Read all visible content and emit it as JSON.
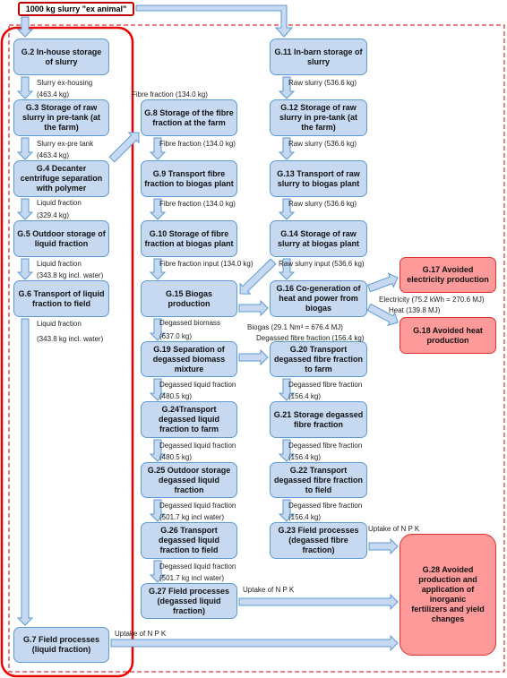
{
  "source": "1000 kg slurry \"ex animal\"",
  "boxes": {
    "g2": "G.2 In-house storage of slurry",
    "g3": "G.3 Storage of raw slurry in pre-tank (at the farm)",
    "g4": "G.4 Decanter centrifuge separation with polymer",
    "g5": "G.5 Outdoor storage of liquid fraction",
    "g6": "G.6 Transport of liquid fraction to field",
    "g7": "G.7 Field processes (liquid fraction)",
    "g8": "G.8 Storage of the fibre fraction at the farm",
    "g9": "G.9 Transport fibre fraction to biogas plant",
    "g10": "G.10 Storage of fibre fraction at biogas plant",
    "g15": "G.15 Biogas production",
    "g19": "G.19 Separation of degassed biomass mixture",
    "g24": "G.24Transport degassed liquid fraction to farm",
    "g25": "G.25 Outdoor storage degassed liquid fraction",
    "g26": "G.26 Transport degassed liquid fraction to field",
    "g27": "G.27 Field processes (degassed liquid fraction)",
    "g11": "G.11 In-barn storage of slurry",
    "g12": "G.12 Storage of raw slurry in pre-tank (at the farm)",
    "g13": "G.13 Transport of raw slurry to biogas plant",
    "g14": "G.14 Storage of raw slurry at biogas plant",
    "g16": "G.16 Co-generation of heat and power from biogas",
    "g20": "G.20 Transport degassed fibre fraction to farm",
    "g21": "G.21 Storage degassed fibre fraction",
    "g22": "G.22 Transport degassed fibre fraction to field",
    "g23": "G.23 Field processes (degassed fibre fraction)",
    "g17": "G.17 Avoided electricity production",
    "g18": "G.18 Avoided heat production",
    "g28": "G.28 Avoided production and application of inorganic fertilizers and yield changes"
  },
  "labels": {
    "l1a": "Slurry ex-housing",
    "l1b": "(463.4 kg)",
    "l2a": "Slurry ex-pre tank",
    "l2b": "(463.4 kg)",
    "l3a": "Liquid fraction",
    "l3b": "(329.4 kg)",
    "l4a": "Liquid fraction",
    "l4b": "(343.8 kg incl. water)",
    "l5a": "Liquid fraction",
    "l5b": "(343.8 kg incl. water)",
    "f0": "Fibre fraction (134.0 kg)",
    "f1": "Fibre fraction (134.0 kg)",
    "f2": "Fibre fraction (134.0 kg)",
    "f3": "Fibre fraction input (134.0 kg)",
    "r1": "Raw slurry (536.6 kg)",
    "r2": "Raw slurry (536.6 kg)",
    "r3": "Raw slurry (536.6 kg)",
    "r4": "Raw slurry input (536.6 kg)",
    "elec": "Electricity (75.2 kWh = 270.6 MJ)",
    "heat": "Heat (139.8 MJ)",
    "biogas": "Biogas (29.1 Nm³ = 676.4 MJ)",
    "dff": "Degassed fibre fraction (156.4 kg)",
    "db1": "Degassed biomass",
    "db2": "(637.0 kg)",
    "d1a": "Degassed liquid fraction",
    "d1b": "(480.5 kg)",
    "d2a": "Degassed liquid fraction",
    "d2b": "(480.5 kg)",
    "d3a": "Degassed liquid fraction",
    "d3b": "(501.7 kg incl water)",
    "d4a": "Degassed liquid fraction",
    "d4b": "(501.7 kg incl water)",
    "e1a": "Degassed fibre fraction",
    "e1b": "(156.4 kg)",
    "e2a": "Degassed fibre fraction",
    "e2b": "(156.4 kg)",
    "e3a": "Degassed fibre fraction",
    "e3b": "(156.4 kg)",
    "u1": "Uptake of N P K",
    "u2": "Uptake of N P K",
    "u3": "Uptake of N P K"
  },
  "colors": {
    "box_fill": "#c6d9f1",
    "box_border": "#5b9bd5",
    "avoided_fill": "#ff9a9a",
    "boundary": "#e00000"
  }
}
